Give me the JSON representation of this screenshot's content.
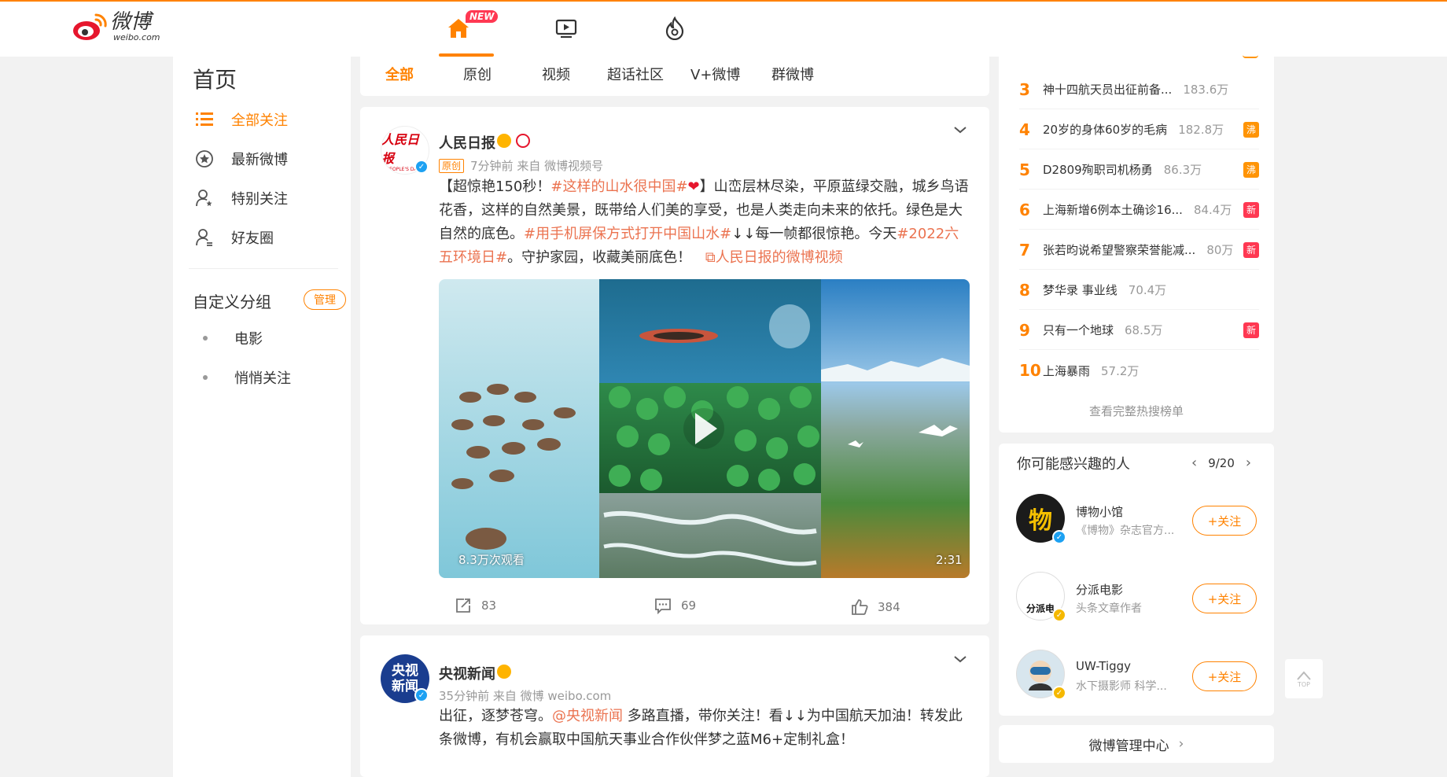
{
  "header": {
    "logo_cn": "微博",
    "logo_en": "weibo.com",
    "new_badge": "NEW",
    "nav": [
      "home-icon",
      "video-icon",
      "hot-icon"
    ]
  },
  "leftnav": {
    "title": "首页",
    "items": [
      {
        "label": "全部关注",
        "icon": "list-icon",
        "active": true
      },
      {
        "label": "最新微博",
        "icon": "star-icon"
      },
      {
        "label": "特别关注",
        "icon": "user-star-icon"
      },
      {
        "label": "好友圈",
        "icon": "users-icon"
      }
    ],
    "group_title": "自定义分组",
    "manage_label": "管理",
    "groups": [
      "电影",
      "悄悄关注"
    ]
  },
  "tabs": [
    "全部",
    "原创",
    "视频",
    "超话社区",
    "V+微博",
    "群微博"
  ],
  "post1": {
    "user": "人民日报",
    "avatar_text": "人民日报",
    "avatar_sub": "PEOPLE'S DAILY",
    "tag": "原创",
    "meta": "7分钟前  来自 微博视频号",
    "text_a": "【超惊艳150秒！",
    "topic1": "#这样的山水很中国#",
    "text_b": "】山峦层林尽染，平原蓝绿交融，城乡鸟语花香，这样的自然美景，既带给人们美的享受，也是人类走向未来的依托。绿色是大自然的底色。",
    "topic2": "#用手机屏保方式打开中国山水#",
    "text_c": "↓↓每一帧都很惊艳。今天",
    "topic3": "#2022六五环境日#",
    "text_d": "。守护家园，收藏美丽底色！",
    "video_link": "人民日报的微博视频",
    "views": "8.3万次观看",
    "duration": "2:31",
    "reposts": "83",
    "comments": "69",
    "likes": "384"
  },
  "post2": {
    "user": "央视新闻",
    "avatar_text": "央视新闻",
    "meta": "35分钟前  来自 微博 weibo.com",
    "text_a": "出征，逐梦苍穹。",
    "mention": "@央视新闻",
    "text_b": " 多路直播，带你关注！看↓↓为中国航天加油！转发此条微博，有机会赢取中国航天事业合作伙伴梦之蓝M6+定制礼盒！"
  },
  "hot": {
    "rows": [
      {
        "rank": "3",
        "title": "神十四航天员出征前备...",
        "num": "183.6万",
        "badge": ""
      },
      {
        "rank": "4",
        "title": "20岁的身体60岁的毛病",
        "num": "182.8万",
        "badge": "沸"
      },
      {
        "rank": "5",
        "title": "D2809殉职司机杨勇",
        "num": "86.3万",
        "badge": "沸"
      },
      {
        "rank": "6",
        "title": "上海新增6例本土确诊16...",
        "num": "84.4万",
        "badge": "新"
      },
      {
        "rank": "7",
        "title": "张若昀说希望警察荣誉能减...",
        "num": "80万",
        "badge": "新"
      },
      {
        "rank": "8",
        "title": "梦华录 事业线",
        "num": "70.4万",
        "badge": ""
      },
      {
        "rank": "9",
        "title": "只有一个地球",
        "num": "68.5万",
        "badge": "新"
      },
      {
        "rank": "10",
        "title": "上海暴雨",
        "num": "57.2万",
        "badge": ""
      }
    ],
    "more": "查看完整热搜榜单"
  },
  "rec": {
    "title": "你可能感兴趣的人",
    "pager": "9/20",
    "follow_label": "+关注",
    "people": [
      {
        "name": "博物小馆",
        "desc": "《博物》杂志官方...",
        "avatar_text": "物"
      },
      {
        "name": "分派电影",
        "desc": "头条文章作者",
        "avatar_text": "分派电"
      },
      {
        "name": "UW-Tiggy",
        "desc": "水下摄影师 科学...",
        "avatar_text": ""
      }
    ]
  },
  "manage_center": "微博管理中心",
  "top_label": "TOP",
  "colors": {
    "accent": "#ff8200",
    "topic": "#eb7350",
    "hot": "#ff9406",
    "new": "#ff3852",
    "verified": "#1da1f2"
  }
}
